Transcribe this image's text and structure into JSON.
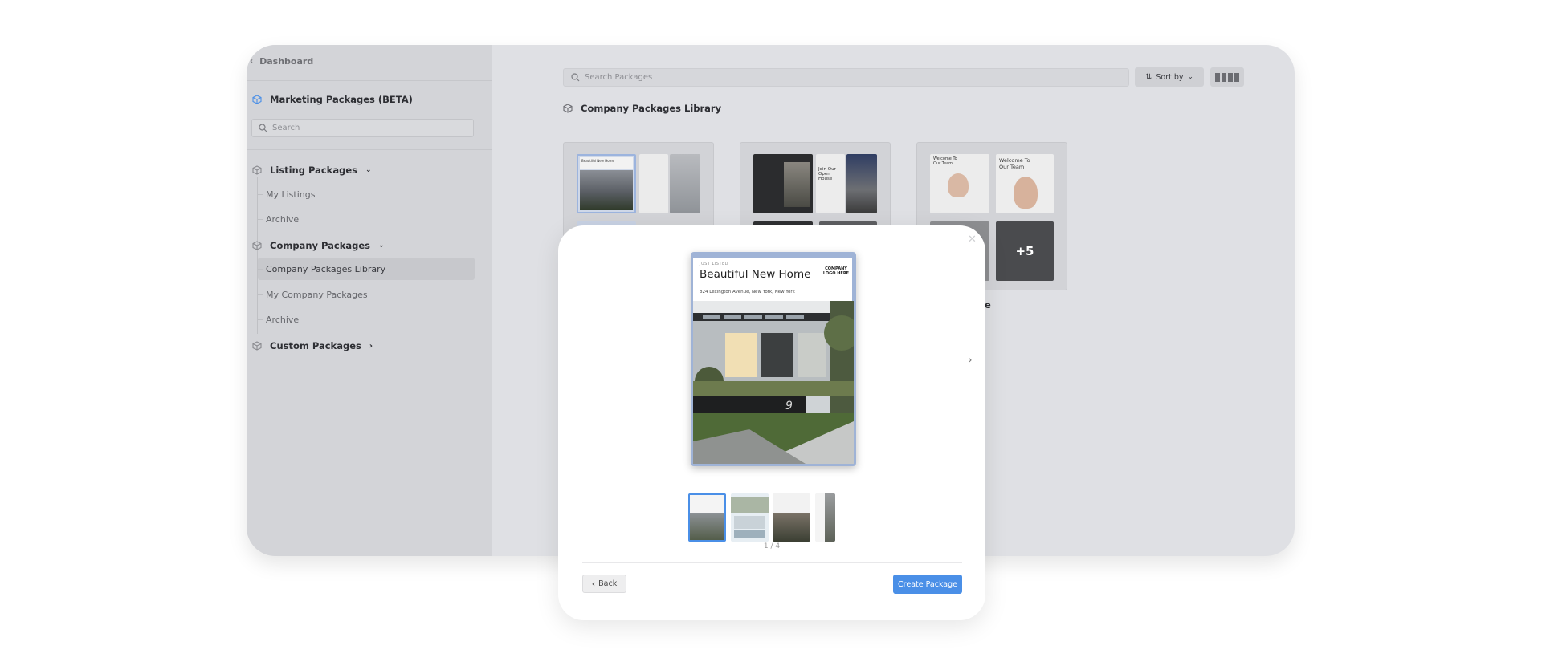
{
  "sidebar": {
    "back_label": "Dashboard",
    "title": "Marketing Packages (BETA)",
    "search_placeholder": "Search",
    "listing": {
      "label": "Listing Packages",
      "items": [
        "My Listings",
        "Archive"
      ]
    },
    "company": {
      "label": "Company Packages",
      "items": [
        "Company Packages Library",
        "My Company Packages",
        "Archive"
      ]
    },
    "custom": {
      "label": "Custom Packages"
    }
  },
  "main": {
    "search_placeholder": "Search Packages",
    "sort_label": "Sort by",
    "section_title": "Company Packages Library",
    "card3_label": "age",
    "card3_more": "+5",
    "card1_flyer_title": "Beautiful New Home",
    "card1_flyer2_line": "Join Our Open House",
    "card3_welcome": "Welcome To Our Team"
  },
  "modal": {
    "flyer": {
      "sub": "JUST LISTED",
      "title": "Beautiful New Home",
      "address": "824 Lexington Avenue, New York, New York",
      "logo": "COMPANY LOGO HERE",
      "house_number": "9"
    },
    "counter": "1 / 4",
    "back_label": "Back",
    "create_label": "Create Package"
  },
  "colors": {
    "accent": "#4a8fe7",
    "overlay": "#dfe0e4"
  }
}
